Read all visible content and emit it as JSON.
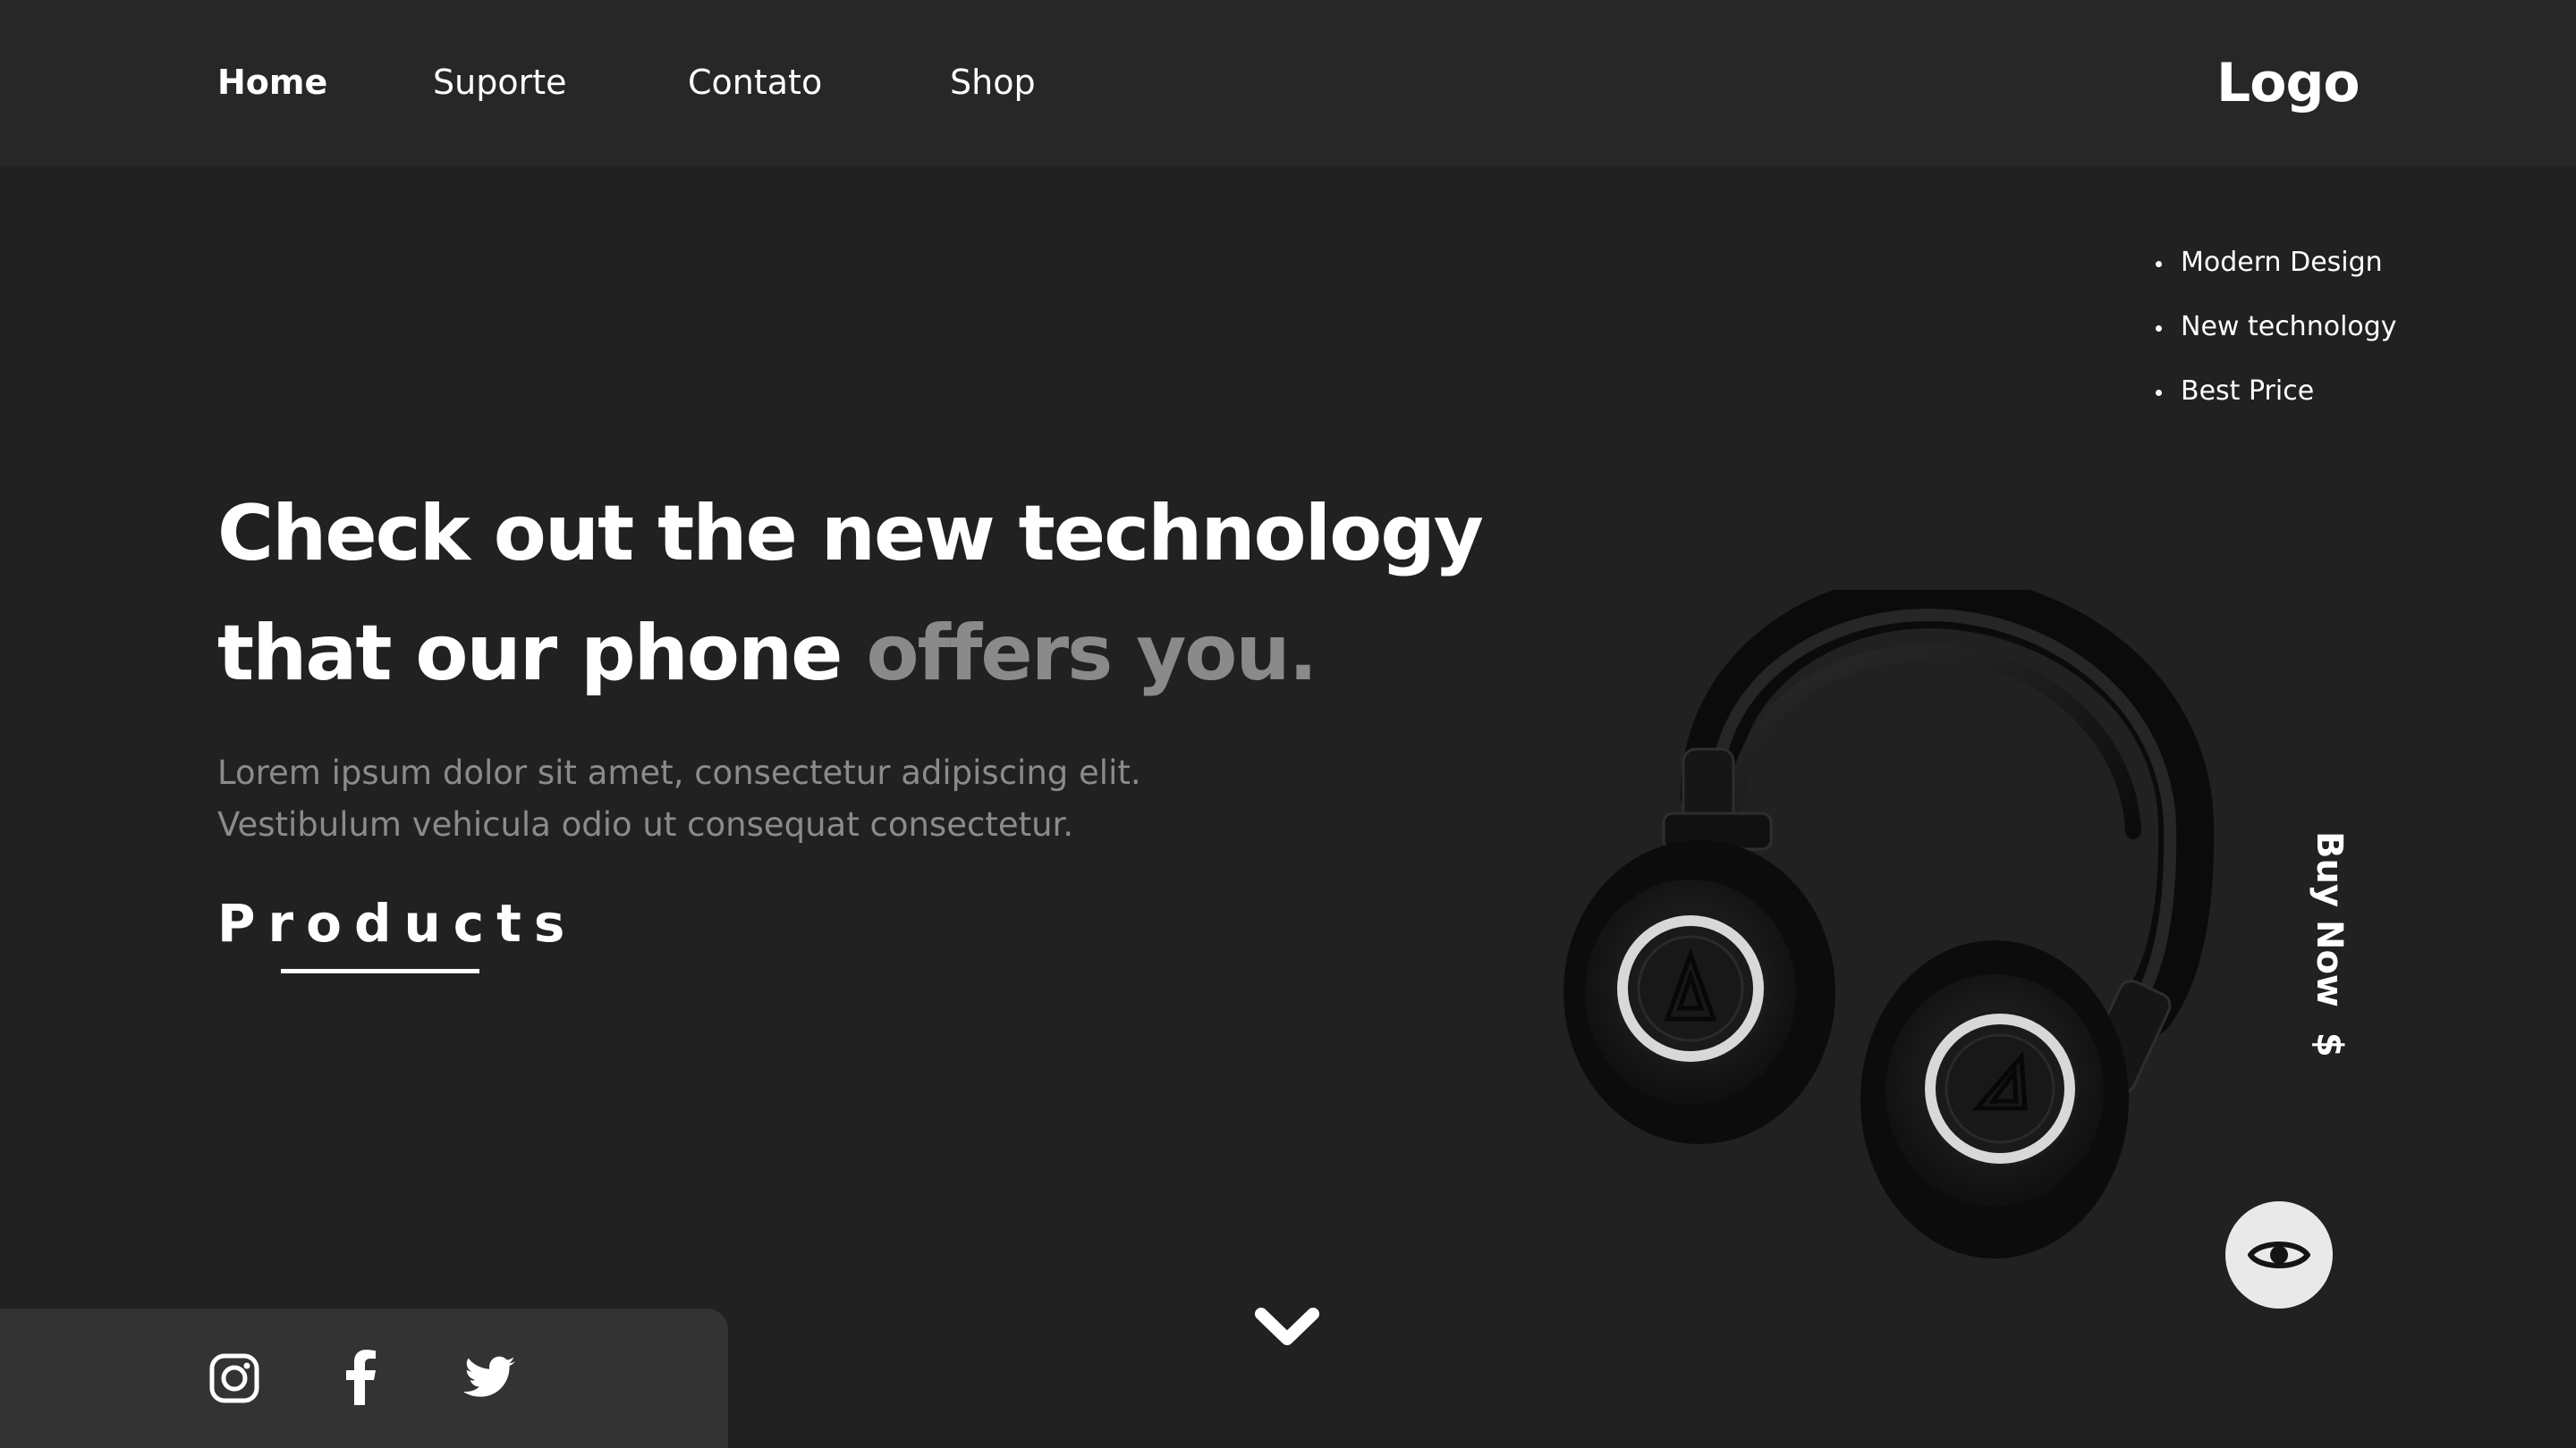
{
  "nav": {
    "items": [
      {
        "label": "Home",
        "active": true
      },
      {
        "label": "Suporte",
        "active": false
      },
      {
        "label": "Contato",
        "active": false
      },
      {
        "label": "Shop",
        "active": false
      }
    ],
    "logo": "Logo"
  },
  "features": [
    "Modern Design",
    "New technology",
    "Best Price"
  ],
  "hero": {
    "headline_line1": "Check out the new technology",
    "headline_line2_main": "that our phone ",
    "headline_line2_accent": "offers you.",
    "description_line1": "Lorem ipsum dolor sit amet, consectetur adipiscing elit.",
    "description_line2": "Vestibulum vehicula odio ut consequat consectetur.",
    "products_label": "Products"
  },
  "buy_now": {
    "label": "Buy Now",
    "symbol": "$"
  },
  "icons": {
    "eye": "eye-icon",
    "scroll": "chevron-down-icon",
    "social": [
      "instagram-icon",
      "facebook-icon",
      "twitter-icon"
    ]
  },
  "colors": {
    "background": "#212121",
    "topbar": "#272727",
    "social_panel": "#333333",
    "accent_text": "#8a8a8a",
    "eye_button": "#e9e9e9"
  }
}
